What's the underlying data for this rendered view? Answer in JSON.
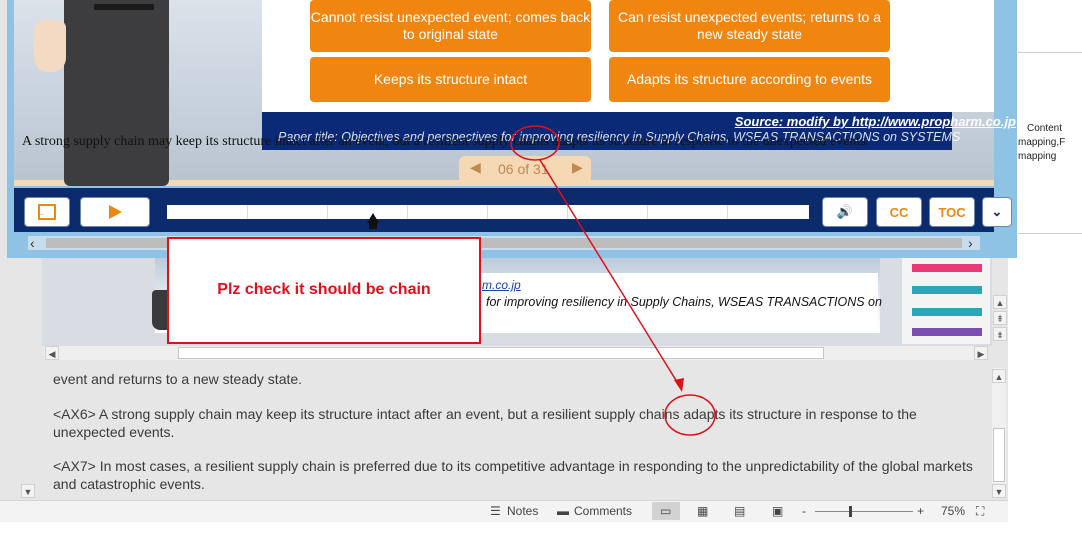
{
  "player": {
    "caption": "A strong supply chain may keep its structure intact after an event, but a resilient supply chains adapts its structure in response to the unexpected events.",
    "boxes": {
      "left_top": "Cannot resist unexpected event; comes back to original state",
      "left_bottom": "Keeps its structure intact",
      "right_top": "Can resist unexpected events; returns to a new steady state",
      "right_bottom": "Adapts its structure according to events"
    },
    "source": "Source: modify by http://www.propharm.co.jp",
    "paper_title": "Paper title: Objectives and perspectives for improving resiliency in Supply Chains, WSEAS TRANSACTIONS on SYSTEMS",
    "pager": "06 of 31",
    "controls": {
      "exit_icon": "exit-icon",
      "play_icon": "play-icon",
      "volume_icon": "volume-icon",
      "cc_label": "CC",
      "toc_label": "TOC",
      "more_icon": "chevron-down-icon"
    }
  },
  "annotation": {
    "text": "Plz check it should be chain",
    "color": "#e0101a"
  },
  "slide": {
    "url_fragment": "m.co.jp",
    "paper_fragment": "for improving resiliency in Supply Chains, WSEAS TRANSACTIONS on"
  },
  "right_pane": {
    "line1": "Content",
    "line2": "mapping,F",
    "line3": "mapping"
  },
  "notes": {
    "line0": "event and returns to a new steady state.",
    "ax6": "<AX6> A strong supply chain may keep its structure intact after an event, but a resilient supply chains adapts its structure in response to the unexpected events.",
    "ax7": "<AX7> In most cases, a resilient supply chain is preferred due to its competitive advantage in responding to the unpredictability of the global markets and catastrophic events."
  },
  "status_bar": {
    "notes_label": "Notes",
    "comments_label": "Comments",
    "zoom_minus": "-",
    "zoom_plus": "+",
    "zoom": "75%"
  },
  "colors": {
    "accent_orange": "#f0860f",
    "navy": "#0b2b6c"
  }
}
